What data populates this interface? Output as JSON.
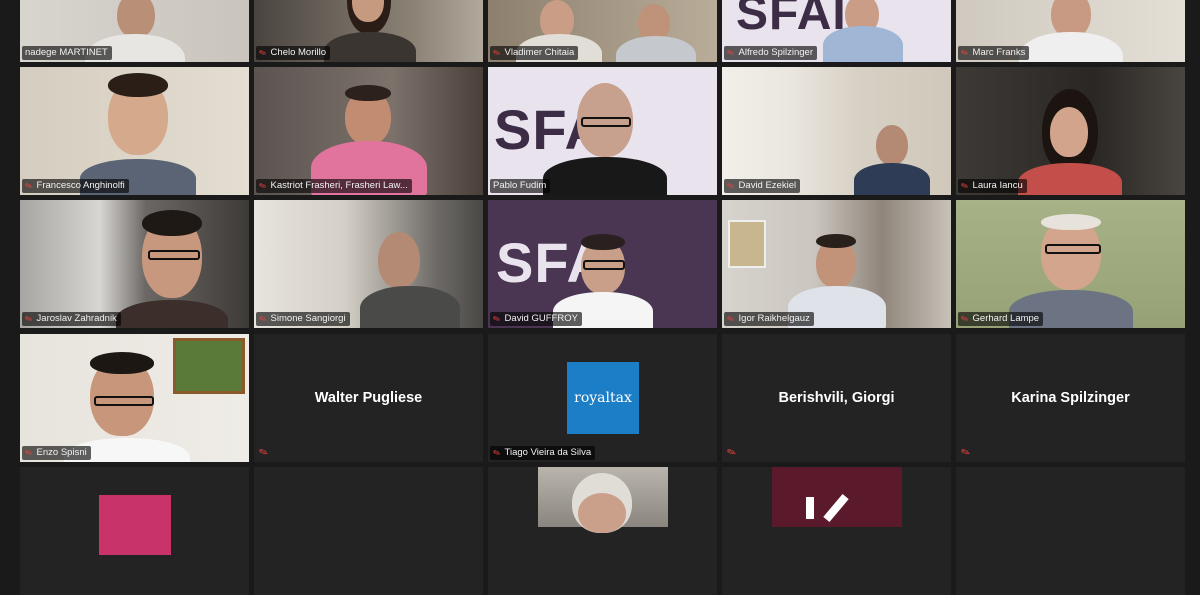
{
  "meeting": {
    "participants": [
      {
        "name": "nadege MARTINET",
        "muted": false
      },
      {
        "name": "Chelo Morillo",
        "muted": true
      },
      {
        "name": "Vladimer Chitaia",
        "muted": true
      },
      {
        "name": "Alfredo Spilzinger",
        "muted": true,
        "active_speaker": true
      },
      {
        "name": "Marc Franks",
        "muted": true
      },
      {
        "name": "Francesco Anghinolfi",
        "muted": true
      },
      {
        "name": "Kastriot Frasheri, Frasheri Law...",
        "muted": true
      },
      {
        "name": "Pablo Fudim",
        "muted": false
      },
      {
        "name": "David Ezekiel",
        "muted": true
      },
      {
        "name": "Laura Iancu",
        "muted": true
      },
      {
        "name": "Jaroslav Zahradnik",
        "muted": true
      },
      {
        "name": "Simone Sangiorgi",
        "muted": true
      },
      {
        "name": "David GUFFROY",
        "muted": true
      },
      {
        "name": "Igor Raikhelgauz",
        "muted": true
      },
      {
        "name": "Gerhard Lampe",
        "muted": true
      },
      {
        "name": "Enzo Spisni",
        "muted": true
      },
      {
        "name": "Walter Pugliese",
        "muted": true,
        "video_off": true
      },
      {
        "name": "Tiago Vieira da Silva",
        "muted": true,
        "video_off": true,
        "logo": "royaltax"
      },
      {
        "name": "Berishvili, Giorgi",
        "muted": true,
        "video_off": true
      },
      {
        "name": "Karina Spilzinger",
        "muted": true,
        "video_off": true
      }
    ],
    "sfai_logo_text": "SFAI",
    "royaltax_logo_text": "royaltax",
    "mute_icon": "mic-muted-icon",
    "colors": {
      "background": "#1a1a1a",
      "tile": "#232323",
      "active_border": "#e7e23b",
      "muted_icon": "#e8413e",
      "royaltax_blue": "#1d7ec8",
      "sfai_bg": "#e9e3ee",
      "sfai_purple": "#4a3552"
    }
  }
}
